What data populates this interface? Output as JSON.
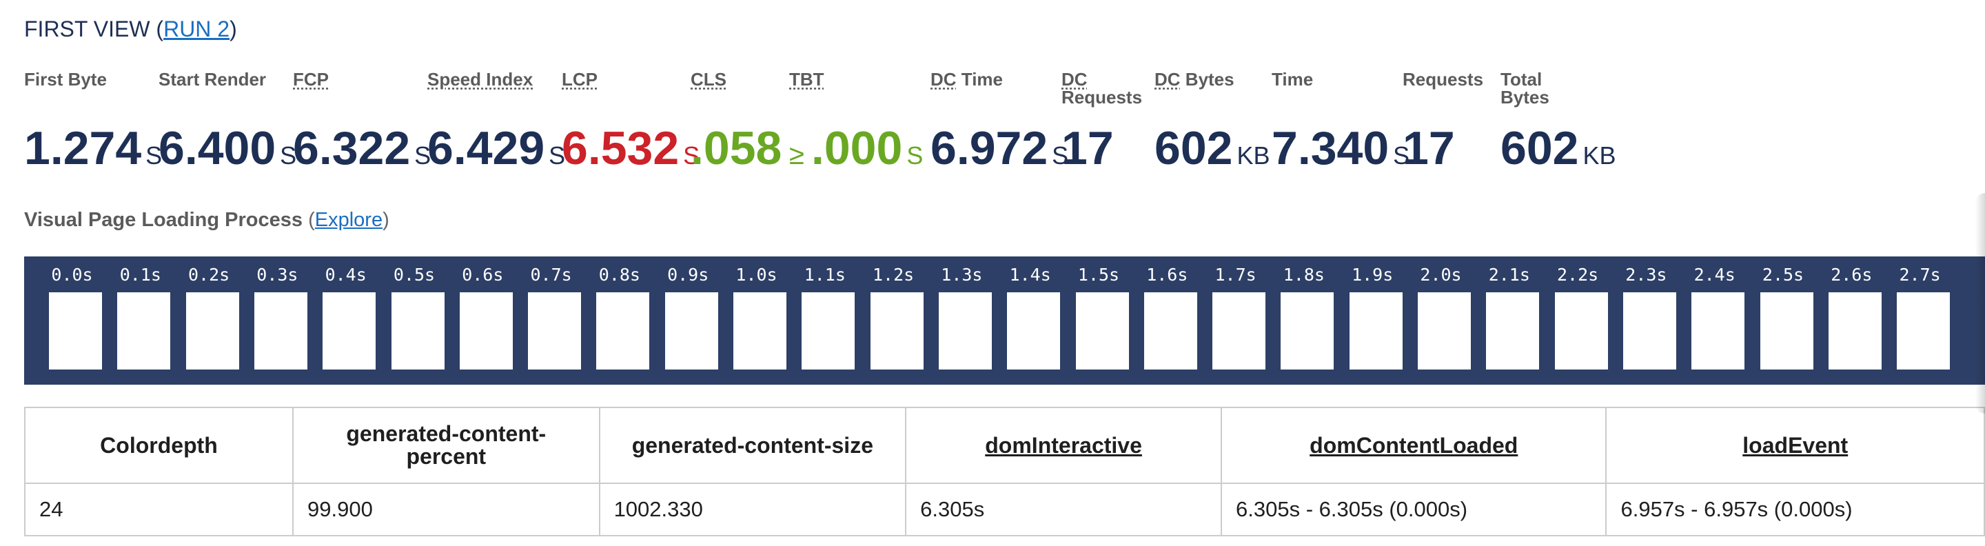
{
  "heading": {
    "prefix": "FIRST VIEW (",
    "run_link": "RUN 2",
    "suffix": ")"
  },
  "metrics": [
    {
      "label": "First Byte",
      "value": "1.274",
      "unit": "S",
      "color": "#1e2f55"
    },
    {
      "label": "Start Render",
      "value": "6.400",
      "unit": "S",
      "color": "#1e2f55"
    },
    {
      "label": "FCP",
      "value": "6.322",
      "unit": "S",
      "color": "#1e2f55"
    },
    {
      "label": "Speed Index",
      "value": "6.429",
      "unit": "S",
      "color": "#1e2f55"
    },
    {
      "label": "LCP",
      "value": "6.532",
      "unit": "S",
      "color": "#cc2229"
    },
    {
      "label": "CLS",
      "value": ".058",
      "unit": "",
      "color": "#6aa823"
    },
    {
      "label": "TBT",
      "prefix": "≥",
      "value": ".000",
      "unit": "S",
      "color": "#6aa823"
    },
    {
      "label_abbr": "DC",
      "label": " Time",
      "value": "6.972",
      "unit": "S",
      "color": "#1e2f55"
    },
    {
      "label_abbr": "DC",
      "label_line2": "Requests",
      "value": "17",
      "unit": "",
      "color": "#1e2f55"
    },
    {
      "label_abbr": "DC",
      "label": " Bytes",
      "value": "602",
      "unit": "KB",
      "color": "#1e2f55"
    },
    {
      "label": "Time",
      "value": "7.340",
      "unit": "S",
      "color": "#1e2f55"
    },
    {
      "label": "Requests",
      "value": "17",
      "unit": "",
      "color": "#1e2f55"
    },
    {
      "label": "Total",
      "label_line2": "Bytes",
      "value": "602",
      "unit": "KB",
      "color": "#1e2f55"
    }
  ],
  "visual": {
    "title": "Visual Page Loading Process",
    "open": "(",
    "link": "Explore",
    "close": ")"
  },
  "filmstrip": {
    "timestamps": [
      "0.0s",
      "0.1s",
      "0.2s",
      "0.3s",
      "0.4s",
      "0.5s",
      "0.6s",
      "0.7s",
      "0.8s",
      "0.9s",
      "1.0s",
      "1.1s",
      "1.2s",
      "1.3s",
      "1.4s",
      "1.5s",
      "1.6s",
      "1.7s",
      "1.8s",
      "1.9s",
      "2.0s",
      "2.1s",
      "2.2s",
      "2.3s",
      "2.4s",
      "2.5s",
      "2.6s",
      "2.7s"
    ]
  },
  "table": {
    "headers": [
      {
        "text": "Colordepth",
        "link": false
      },
      {
        "text": "generated-content-percent",
        "link": false
      },
      {
        "text": "generated-content-size",
        "link": false
      },
      {
        "text": "domInteractive",
        "link": true
      },
      {
        "text": "domContentLoaded",
        "link": true
      },
      {
        "text": "loadEvent",
        "link": true
      }
    ],
    "row": [
      "24",
      "99.900",
      "1002.330",
      "6.305s",
      "6.305s - 6.305s (0.000s)",
      "6.957s - 6.957s (0.000s)"
    ]
  }
}
